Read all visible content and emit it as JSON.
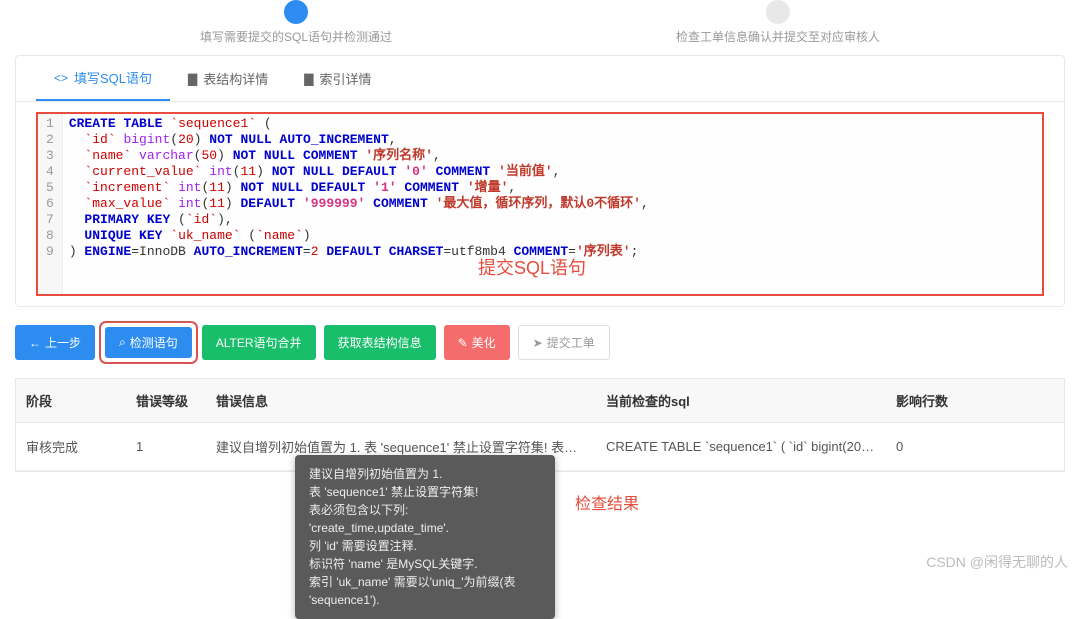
{
  "steps": {
    "step1": "填写需要提交的SQL语句并检测通过",
    "step2": "检查工单信息确认并提交至对应审核人"
  },
  "tabs": {
    "fill_sql": "填写SQL语句",
    "table_struct": "表结构详情",
    "index_detail": "索引详情"
  },
  "code": {
    "lines": [
      "1",
      "2",
      "3",
      "4",
      "5",
      "6",
      "7",
      "8",
      "9"
    ],
    "annotation": "提交SQL语句"
  },
  "buttons": {
    "prev": "上一步",
    "check": "检测语句",
    "alter_merge": "ALTER语句合并",
    "get_struct": "获取表结构信息",
    "beautify": "美化",
    "submit": "提交工单"
  },
  "table": {
    "headers": {
      "stage": "阶段",
      "level": "错误等级",
      "msg": "错误信息",
      "sql": "当前检查的sql",
      "rows": "影响行数"
    },
    "row": {
      "stage": "审核完成",
      "level": "1",
      "msg": "建议自增列初始值置为 1. 表 'sequence1' 禁止设置字符集! 表必须包含以下列: 'creat…",
      "sql": "CREATE TABLE `sequence1` ( `id` bigint(20) NOT NULL A…",
      "rows": "0"
    }
  },
  "tooltip": {
    "l1": "建议自增列初始值置为 1.",
    "l2": "表 'sequence1' 禁止设置字符集!",
    "l3": "表必须包含以下列: 'create_time,update_time'.",
    "l4": "列 'id' 需要设置注释.",
    "l5": "标识符 'name' 是MySQL关键字.",
    "l6": "索引 'uk_name' 需要以'uniq_'为前缀(表 'sequence1')."
  },
  "result_label": "检查结果",
  "watermark": "CSDN @闲得无聊的人"
}
